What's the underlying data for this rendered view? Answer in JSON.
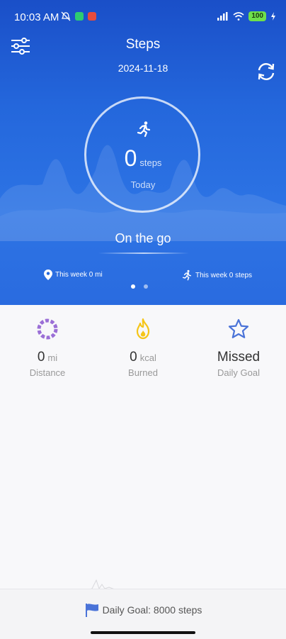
{
  "status": {
    "time": "10:03 AM",
    "battery": "100"
  },
  "header": {
    "title": "Steps",
    "date": "2024-11-18"
  },
  "ring": {
    "value": "0",
    "unit": "steps",
    "label": "Today"
  },
  "activity": "On the go",
  "week": {
    "distance": "This week 0 mi",
    "steps": "This week 0 steps"
  },
  "stats": [
    {
      "value": "0",
      "unit": "mi",
      "label": "Distance",
      "icon": "distance-ring-icon",
      "color": "#9b6fd6"
    },
    {
      "value": "0",
      "unit": "kcal",
      "label": "Burned",
      "icon": "flame-icon",
      "color": "#f5c518"
    },
    {
      "value": "Missed",
      "unit": "",
      "label": "Daily Goal",
      "icon": "star-icon",
      "color": "#4a73d8"
    }
  ],
  "footer": {
    "goal": "Daily Goal: 8000 steps"
  },
  "colors": {
    "hero": "#2467dc",
    "accent": "#4a73d8"
  }
}
